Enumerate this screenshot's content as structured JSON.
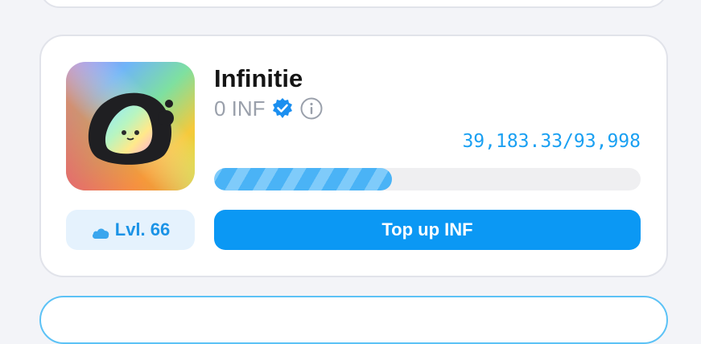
{
  "profile": {
    "name": "Infinitie",
    "balance": "0 INF",
    "verified_icon": "verified-badge-icon",
    "info_icon": "info-icon"
  },
  "level": {
    "icon": "cloud-icon",
    "label": "Lvl. 66"
  },
  "progress": {
    "current": 39183.33,
    "max": 93998,
    "text": "39,183.33/93,998"
  },
  "actions": {
    "topup_label": "Top up INF"
  },
  "colors": {
    "accent": "#0b98f4",
    "progress_fill": "#4ab3f6",
    "level_bg": "#e5f2fd",
    "level_text": "#1b93e6"
  }
}
